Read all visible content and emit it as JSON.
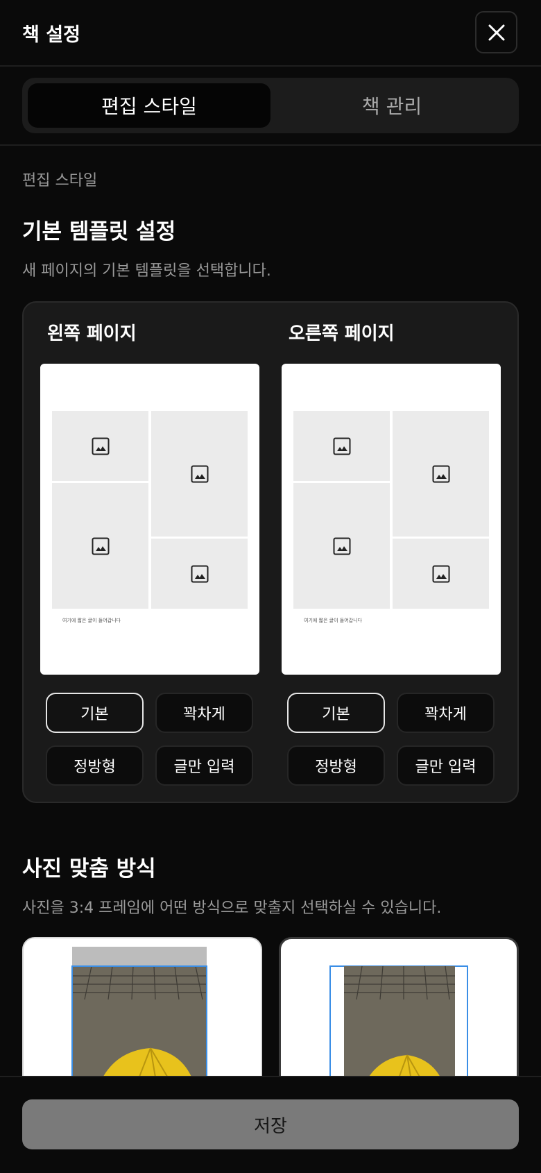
{
  "header": {
    "title": "책 설정",
    "close_icon": "close-icon"
  },
  "tabs": [
    {
      "label": "편집 스타일",
      "active": true
    },
    {
      "label": "책 관리",
      "active": false
    }
  ],
  "section_label": "편집 스타일",
  "template": {
    "title": "기본 템플릿 설정",
    "description": "새 페이지의 기본 템플릿을 선택합니다.",
    "left": {
      "title": "왼쪽 페이지",
      "caption": "여기에 짧은 글이 들어갑니다",
      "options": [
        "기본",
        "꽉차게",
        "정방형",
        "글만 입력"
      ],
      "selected": "기본"
    },
    "right": {
      "title": "오른쪽 페이지",
      "caption": "여기에 짧은 글이 들어갑니다",
      "options": [
        "기본",
        "꽉차게",
        "정방형",
        "글만 입력"
      ],
      "selected": "기본"
    }
  },
  "fit": {
    "title": "사진 맞춤 방식",
    "description": "사진을 3:4 프레임에 어떤 방식으로 맞출지 선택하실 수 있습니다."
  },
  "footer": {
    "save_label": "저장"
  },
  "colors": {
    "background": "#0a0a0a",
    "card": "#1a1a1a",
    "frame_outline": "#3a8ee6",
    "umbrella": "#e8c21c"
  }
}
